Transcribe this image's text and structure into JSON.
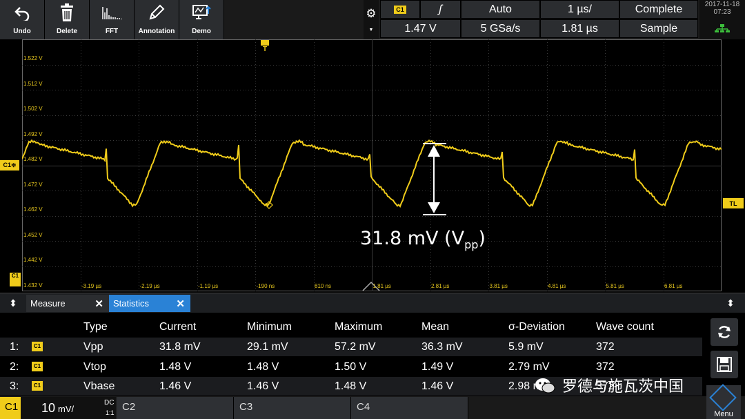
{
  "toolbar": {
    "buttons": [
      {
        "label": "Undo",
        "icon": "undo-icon"
      },
      {
        "label": "Delete",
        "icon": "trash-icon"
      },
      {
        "label": "FFT",
        "icon": "fft-icon"
      },
      {
        "label": "Annotation",
        "icon": "pencil-icon"
      },
      {
        "label": "Demo",
        "icon": "demo-icon"
      }
    ]
  },
  "acq": {
    "channel_chip": "C1",
    "trigger_slope_symbol": "ʃ",
    "trigger_mode": "Auto",
    "time_per_div": "1 µs/",
    "acq_state": "Complete",
    "trigger_level": "1.47 V",
    "sample_rate": "5 GSa/s",
    "position": "1.81 µs",
    "acq_mode": "Sample"
  },
  "datetime": {
    "date": "2017-11-18",
    "time": "07:23"
  },
  "scope": {
    "vlabels": [
      "1.522 V",
      "1.512 V",
      "1.502 V",
      "1.492 V",
      "1.482 V",
      "1.472 V",
      "1.462 V",
      "1.452 V",
      "1.442 V",
      "1.432 V"
    ],
    "tlabels": [
      "-3.19 µs",
      "-2.19 µs",
      "-1.19 µs",
      "-190 ns",
      "810 ns",
      "1.81 µs",
      "2.81 µs",
      "3.81 µs",
      "4.81 µs",
      "5.81 µs",
      "6.81 µs"
    ],
    "ch_marker": "C1≑",
    "trigger_marker": "T",
    "tl_marker": "TL",
    "bottom_marker": "C1",
    "measure_value": "31.8 mV (V",
    "measure_sub": "pp",
    "measure_close": ")"
  },
  "tabs": [
    {
      "label": "Measure",
      "close": "✕"
    },
    {
      "label": "Statistics",
      "close": "✕"
    }
  ],
  "stats": {
    "headers": [
      "Type",
      "Current",
      "Minimum",
      "Maximum",
      "Mean",
      "σ-Deviation",
      "Wave count"
    ],
    "rows": [
      {
        "index": "1:",
        "chip": "C1",
        "type": "Vpp",
        "current": "31.8 mV",
        "minimum": "29.1 mV",
        "maximum": "57.2 mV",
        "mean": "36.3 mV",
        "sigma": "5.9 mV",
        "count": "372"
      },
      {
        "index": "2:",
        "chip": "C1",
        "type": "Vtop",
        "current": "1.48 V",
        "minimum": "1.48 V",
        "maximum": "1.50 V",
        "mean": "1.49 V",
        "sigma": "2.79 mV",
        "count": "372"
      },
      {
        "index": "3:",
        "chip": "C1",
        "type": "Vbase",
        "current": "1.46 V",
        "minimum": "1.46 V",
        "maximum": "1.48 V",
        "mean": "1.46 V",
        "sigma": "2.98 mV",
        "count": "372"
      }
    ]
  },
  "channels": [
    {
      "label": "C1",
      "active": true
    },
    {
      "label": "C2",
      "active": false
    },
    {
      "label": "C3",
      "active": false
    },
    {
      "label": "C4",
      "active": false
    }
  ],
  "ch1_info": {
    "scale": "10",
    "unit": "mV/",
    "coupling": "DC",
    "ratio": "1:1"
  },
  "watermark": "罗德与施瓦茨中国",
  "menu_label": "Menu",
  "colors": {
    "trace": "#f0cc1a",
    "accent": "#2a82d6"
  }
}
